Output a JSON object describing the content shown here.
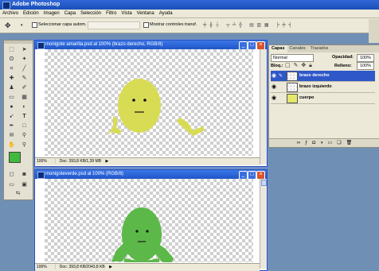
{
  "app": {
    "title": "Adobe Photoshop"
  },
  "menu": [
    "Archivo",
    "Edición",
    "Imagen",
    "Capa",
    "Selección",
    "Filtro",
    "Vista",
    "Ventana",
    "Ayuda"
  ],
  "options": {
    "auto_select_label": "Seleccionar capa autom.",
    "show_controls_label": "Mostrar controles transf."
  },
  "doc1": {
    "title": "monigote amarilla.psd al 100% (brazo derecho, RGB/8)",
    "zoom": "100%",
    "doc_info": "Doc: 393,8 KB/1,39 MB"
  },
  "doc2": {
    "title": "monigoteverde.psd al 100% (RGB/8)",
    "zoom": "100%",
    "doc_info": "Doc: 393,8 KB/2043,8 KB"
  },
  "layers_panel": {
    "tabs": [
      "Capas",
      "Canales",
      "Trazados"
    ],
    "blend_mode": "Normal",
    "opacity_label": "Opacidad:",
    "opacity_value": "100%",
    "lock_label": "Bloq.:",
    "fill_label": "Relleno:",
    "fill_value": "100%",
    "layers": [
      {
        "name": "brazo derecho",
        "selected": true
      },
      {
        "name": "brazo izquierdo",
        "selected": false
      },
      {
        "name": "cuerpo",
        "selected": false
      }
    ]
  },
  "colors": {
    "yellow_figure": "#d8dc55",
    "green_figure": "#5cb848",
    "foreground_swatch": "#3fba3c",
    "selection": "#2f57c8"
  }
}
